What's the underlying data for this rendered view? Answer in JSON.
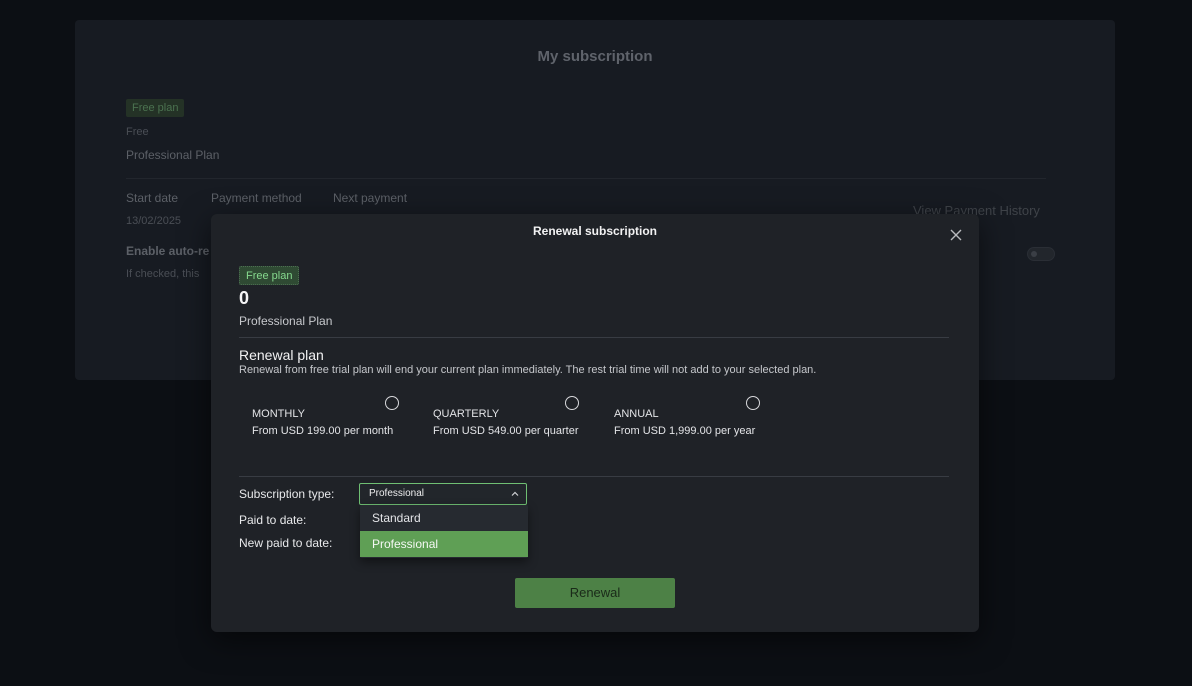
{
  "background": {
    "title": "My subscription",
    "badge": "Free plan",
    "price_label": "Free",
    "plan_name": "Professional Plan",
    "columns": [
      "Start date",
      "Payment method",
      "Next payment"
    ],
    "start_date": "13/02/2025",
    "auto_renew_label": "Enable auto-re",
    "auto_renew_note": "If checked, this",
    "history_link": "View Payment History"
  },
  "modal": {
    "title": "Renewal subscription",
    "badge": "Free plan",
    "amount": "0",
    "plan_name": "Professional Plan",
    "renewal_heading": "Renewal plan",
    "renewal_note": "Renewal from free trial plan will end your current plan immediately. The rest trial time will not add to your selected plan.",
    "options": [
      {
        "name": "MONTHLY",
        "price": "From USD 199.00 per month"
      },
      {
        "name": "QUARTERLY",
        "price": "From USD 549.00 per quarter"
      },
      {
        "name": "ANNUAL",
        "price": "From USD 1,999.00 per year"
      }
    ],
    "subscription_type_label": "Subscription type:",
    "subscription_type_value": "Professional",
    "dropdown_options": [
      "Standard",
      "Professional"
    ],
    "paid_to_date_label": "Paid to date:",
    "new_paid_to_date_label": "New paid to date:",
    "renew_button": "Renewal"
  },
  "colors": {
    "accent": "#6fbf73",
    "selected_option": "#5f9f55",
    "button": "#4d8146"
  },
  "icons": {
    "close": "close-icon",
    "chevron": "chevron-up-icon"
  }
}
